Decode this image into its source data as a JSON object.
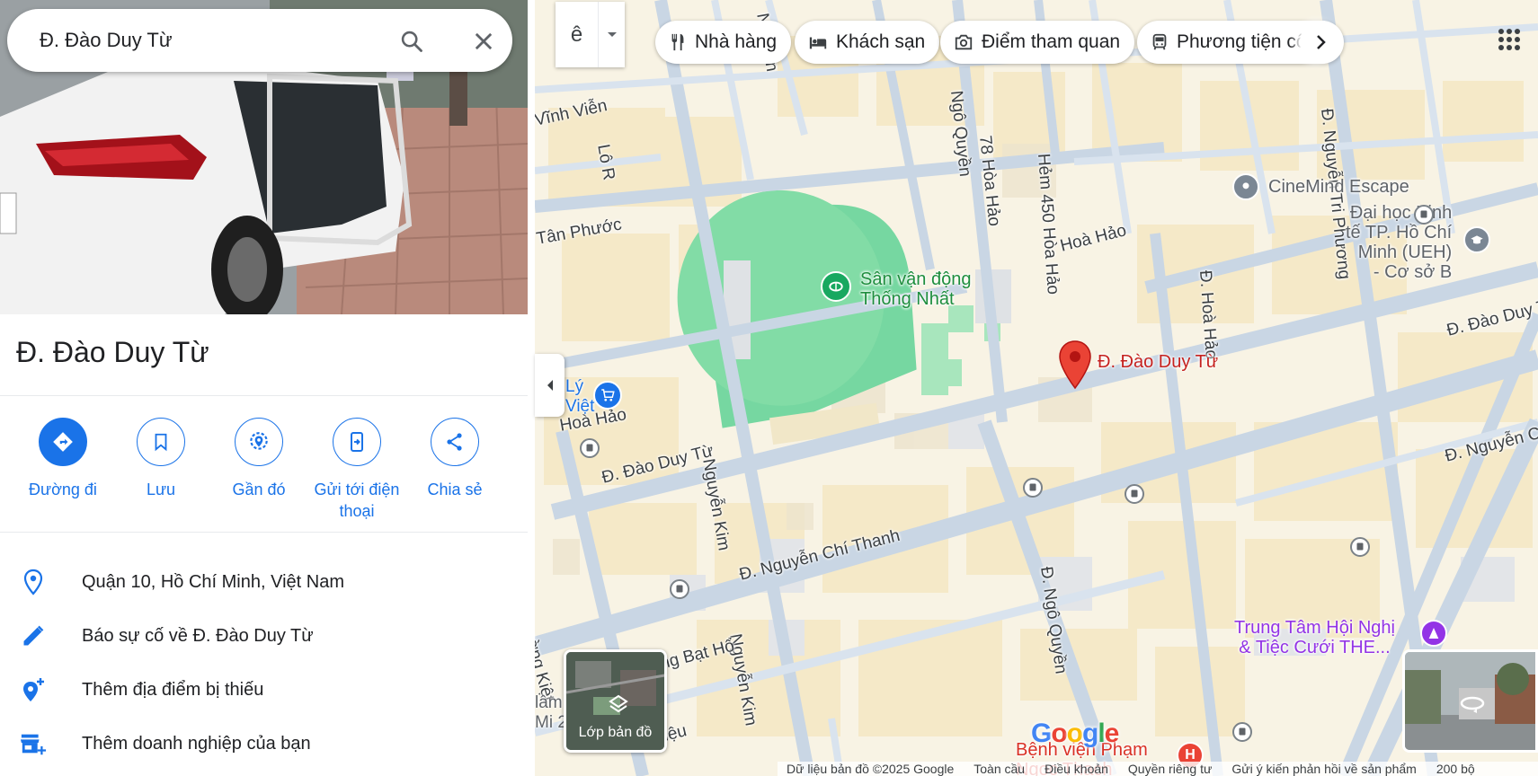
{
  "search": {
    "value": "Đ. Đào Duy Từ"
  },
  "place": {
    "title": "Đ. Đào Duy Từ"
  },
  "actions": [
    {
      "label": "Đường đi",
      "icon": "directions-icon"
    },
    {
      "label": "Lưu",
      "icon": "bookmark-icon"
    },
    {
      "label": "Gần đó",
      "icon": "nearby-icon"
    },
    {
      "label": "Gửi tới điện thoại",
      "icon": "send-to-phone-icon"
    },
    {
      "label": "Chia sẻ",
      "icon": "share-icon"
    }
  ],
  "info": [
    {
      "text": "Quận 10, Hồ Chí Minh, Việt Nam",
      "icon": "location-pin-icon"
    },
    {
      "text": "Báo sự cố về Đ. Đào Duy Từ",
      "icon": "pencil-icon"
    },
    {
      "text": "Thêm địa điểm bị thiếu",
      "icon": "add-location-icon"
    },
    {
      "text": "Thêm doanh nghiệp của bạn",
      "icon": "add-business-icon"
    }
  ],
  "map": {
    "language_button": "ê",
    "chips": [
      {
        "label": "Nhà hàng",
        "icon": "restaurant-icon"
      },
      {
        "label": "Khách sạn",
        "icon": "hotel-icon"
      },
      {
        "label": "Điểm tham quan",
        "icon": "camera-icon"
      },
      {
        "label": "Phương tiện công c",
        "icon": "transit-icon"
      }
    ],
    "pin_label": "Đ. Đào Duy Từ",
    "layers_label": "Lớp bản đồ",
    "google_logo": "Google",
    "pois": {
      "stadium": "Sân vận động\nThống Nhất",
      "cinemind": "CineMind Escape",
      "ueh": "Đại học Kinh\ntế TP. Hồ Chí\nMinh (UEH)\n- Cơ sở B",
      "wedding": "Trung Tâm Hội Nghị\n& Tiệc Cưới THE...",
      "hospital": "Bệnh viện Phạm\nNgọc Thạch",
      "ly_viet": "Lý\nViệt",
      "lam_mi": "lâm\nMi 2"
    },
    "streets": {
      "dao_duy_tu_west": "Đ. Đào Duy Từ",
      "dao_duy_tu_east": "Đ. Đào Duy Từ",
      "nguyen_chi_thanh_west": "Đ. Nguyễn Chí Thanh",
      "nguyen_chi_thanh_east": "Đ. Nguyễn Chí Thanh",
      "nguyen_kim_1": "Nguyễn Kim",
      "nguyen_kim_2": "Nguyễn Kim",
      "ngo_quyen_north": "Ngô Quyền",
      "ngo_quyen_south": "Đ. Ngô Quyền",
      "hoa_hao_west": "Hoà Hảo",
      "hoa_hao_east": "Hoà Hảo",
      "hem_78": "78 Hòa Hảo",
      "hem_450": "Hẻm 450 Hòa Hảo",
      "d_hoa_hao": "Đ. Hoà Hảo",
      "nguyen_tri_phuong": "Đ. Nguyễn Tri Phương",
      "tan_phuoc": "Tân Phước",
      "vinh_vien": "Vĩnh Viễn",
      "lo_r": "Lô R",
      "ly_thuong_kiet": "Đ. Lý Thường Kiệt",
      "tang_bat_ho": "Đ. Tăng Bạt Hổ",
      "ba_trieu": "Bà Triệu",
      "nguyen_top": "Nguyễn"
    },
    "footer": [
      "Dữ liệu bản đồ ©2025 Google",
      "Toàn cầu",
      "Điều khoản",
      "Quyền riêng tư",
      "Gửi ý kiến phản hồi về sản phẩm",
      "200 bộ"
    ]
  }
}
